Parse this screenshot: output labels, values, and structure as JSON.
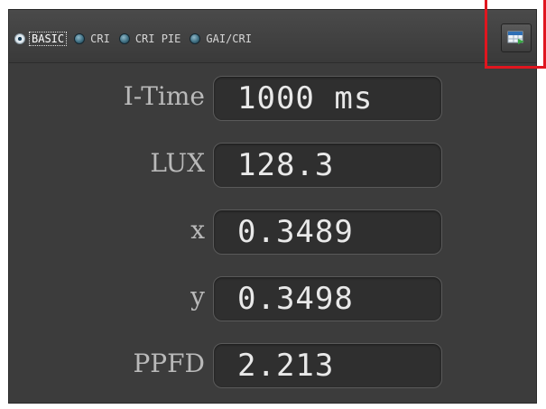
{
  "modes": [
    {
      "label": "BASIC",
      "selected": true
    },
    {
      "label": "CRI",
      "selected": false
    },
    {
      "label": "CRI PIE",
      "selected": false
    },
    {
      "label": "GAI/CRI",
      "selected": false
    }
  ],
  "measurements": [
    {
      "label": "I-Time",
      "value": "1000 ms"
    },
    {
      "label": "LUX",
      "value": "128.3"
    },
    {
      "label": "x",
      "value": "0.3489"
    },
    {
      "label": "y",
      "value": "0.3498"
    },
    {
      "label": "PPFD",
      "value": "2.213"
    }
  ],
  "colors": {
    "panel_bg": "#3c3c3c",
    "highlight": "#e0161f",
    "value_text": "#e9e9e9",
    "label_text": "#b9b9b9"
  },
  "icons": {
    "action_button": "table-export-icon"
  }
}
